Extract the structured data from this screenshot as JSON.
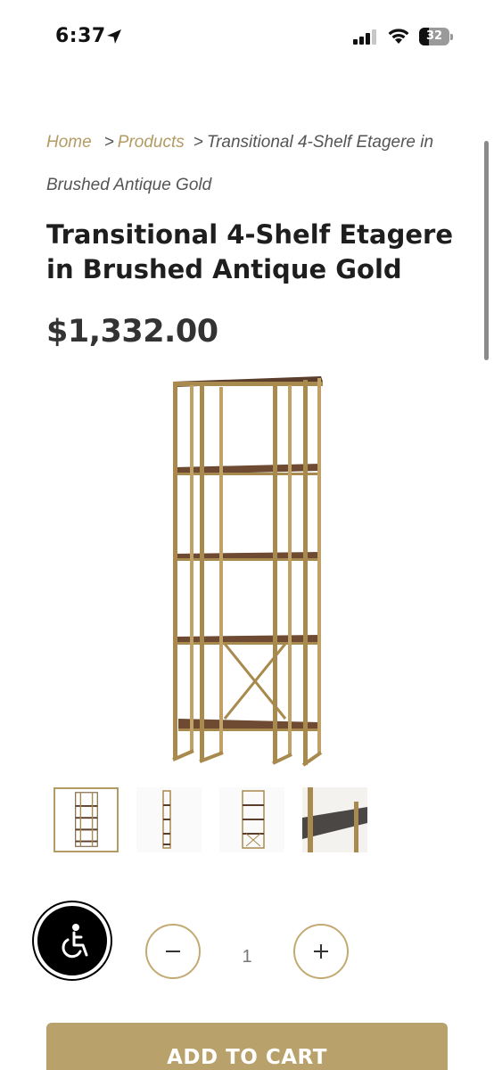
{
  "status_bar": {
    "time": "6:37",
    "battery": "32",
    "icons": [
      "location-arrow-icon",
      "signal-bars-icon",
      "wifi-icon",
      "battery-icon"
    ]
  },
  "breadcrumb": {
    "home": "Home",
    "sep1": ">",
    "products": "Products",
    "sep2": ">",
    "current": "Transitional 4-Shelf Etagere in Brushed Antique Gold"
  },
  "product": {
    "title": "Transitional 4-Shelf Etagere in Brushed Antique Gold",
    "price": "$1,332.00",
    "thumbnail_count": 4
  },
  "quantity": {
    "value": "1"
  },
  "actions": {
    "add_to_cart": "ADD TO CART"
  },
  "colors": {
    "accent_gold": "#b39b63",
    "button_gold": "#b8a16a",
    "frame_gold": "#a88a4e",
    "shelf_wood": "#6e4a32"
  }
}
